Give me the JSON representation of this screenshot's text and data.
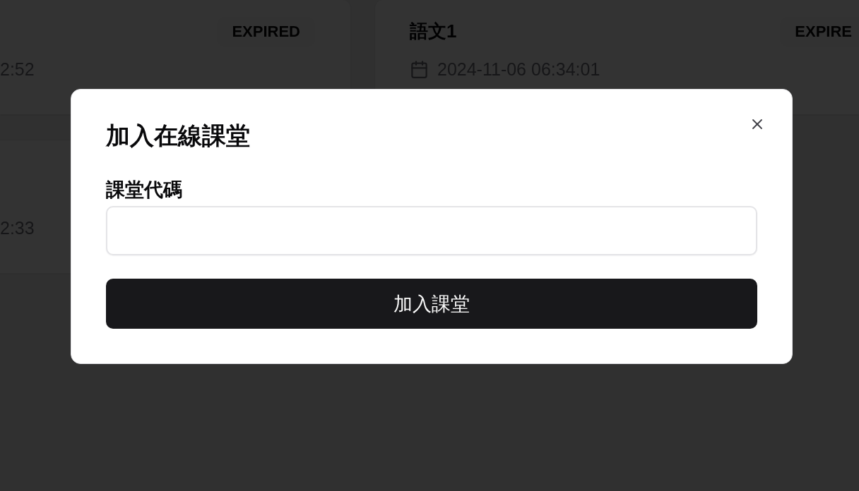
{
  "background_cards": [
    {
      "kind": "clipped",
      "status_badge": "EXPIRED",
      "date": "2:52"
    },
    {
      "kind": "full",
      "title": "語文1",
      "date": "2024-11-06 06:34:01",
      "status_badge": "EXPIRE"
    },
    {
      "kind": "clipped",
      "date": "2:33"
    }
  ],
  "dialog": {
    "title": "加入在線課堂",
    "field_label": "課堂代碼",
    "submit_button": "加入課堂"
  }
}
